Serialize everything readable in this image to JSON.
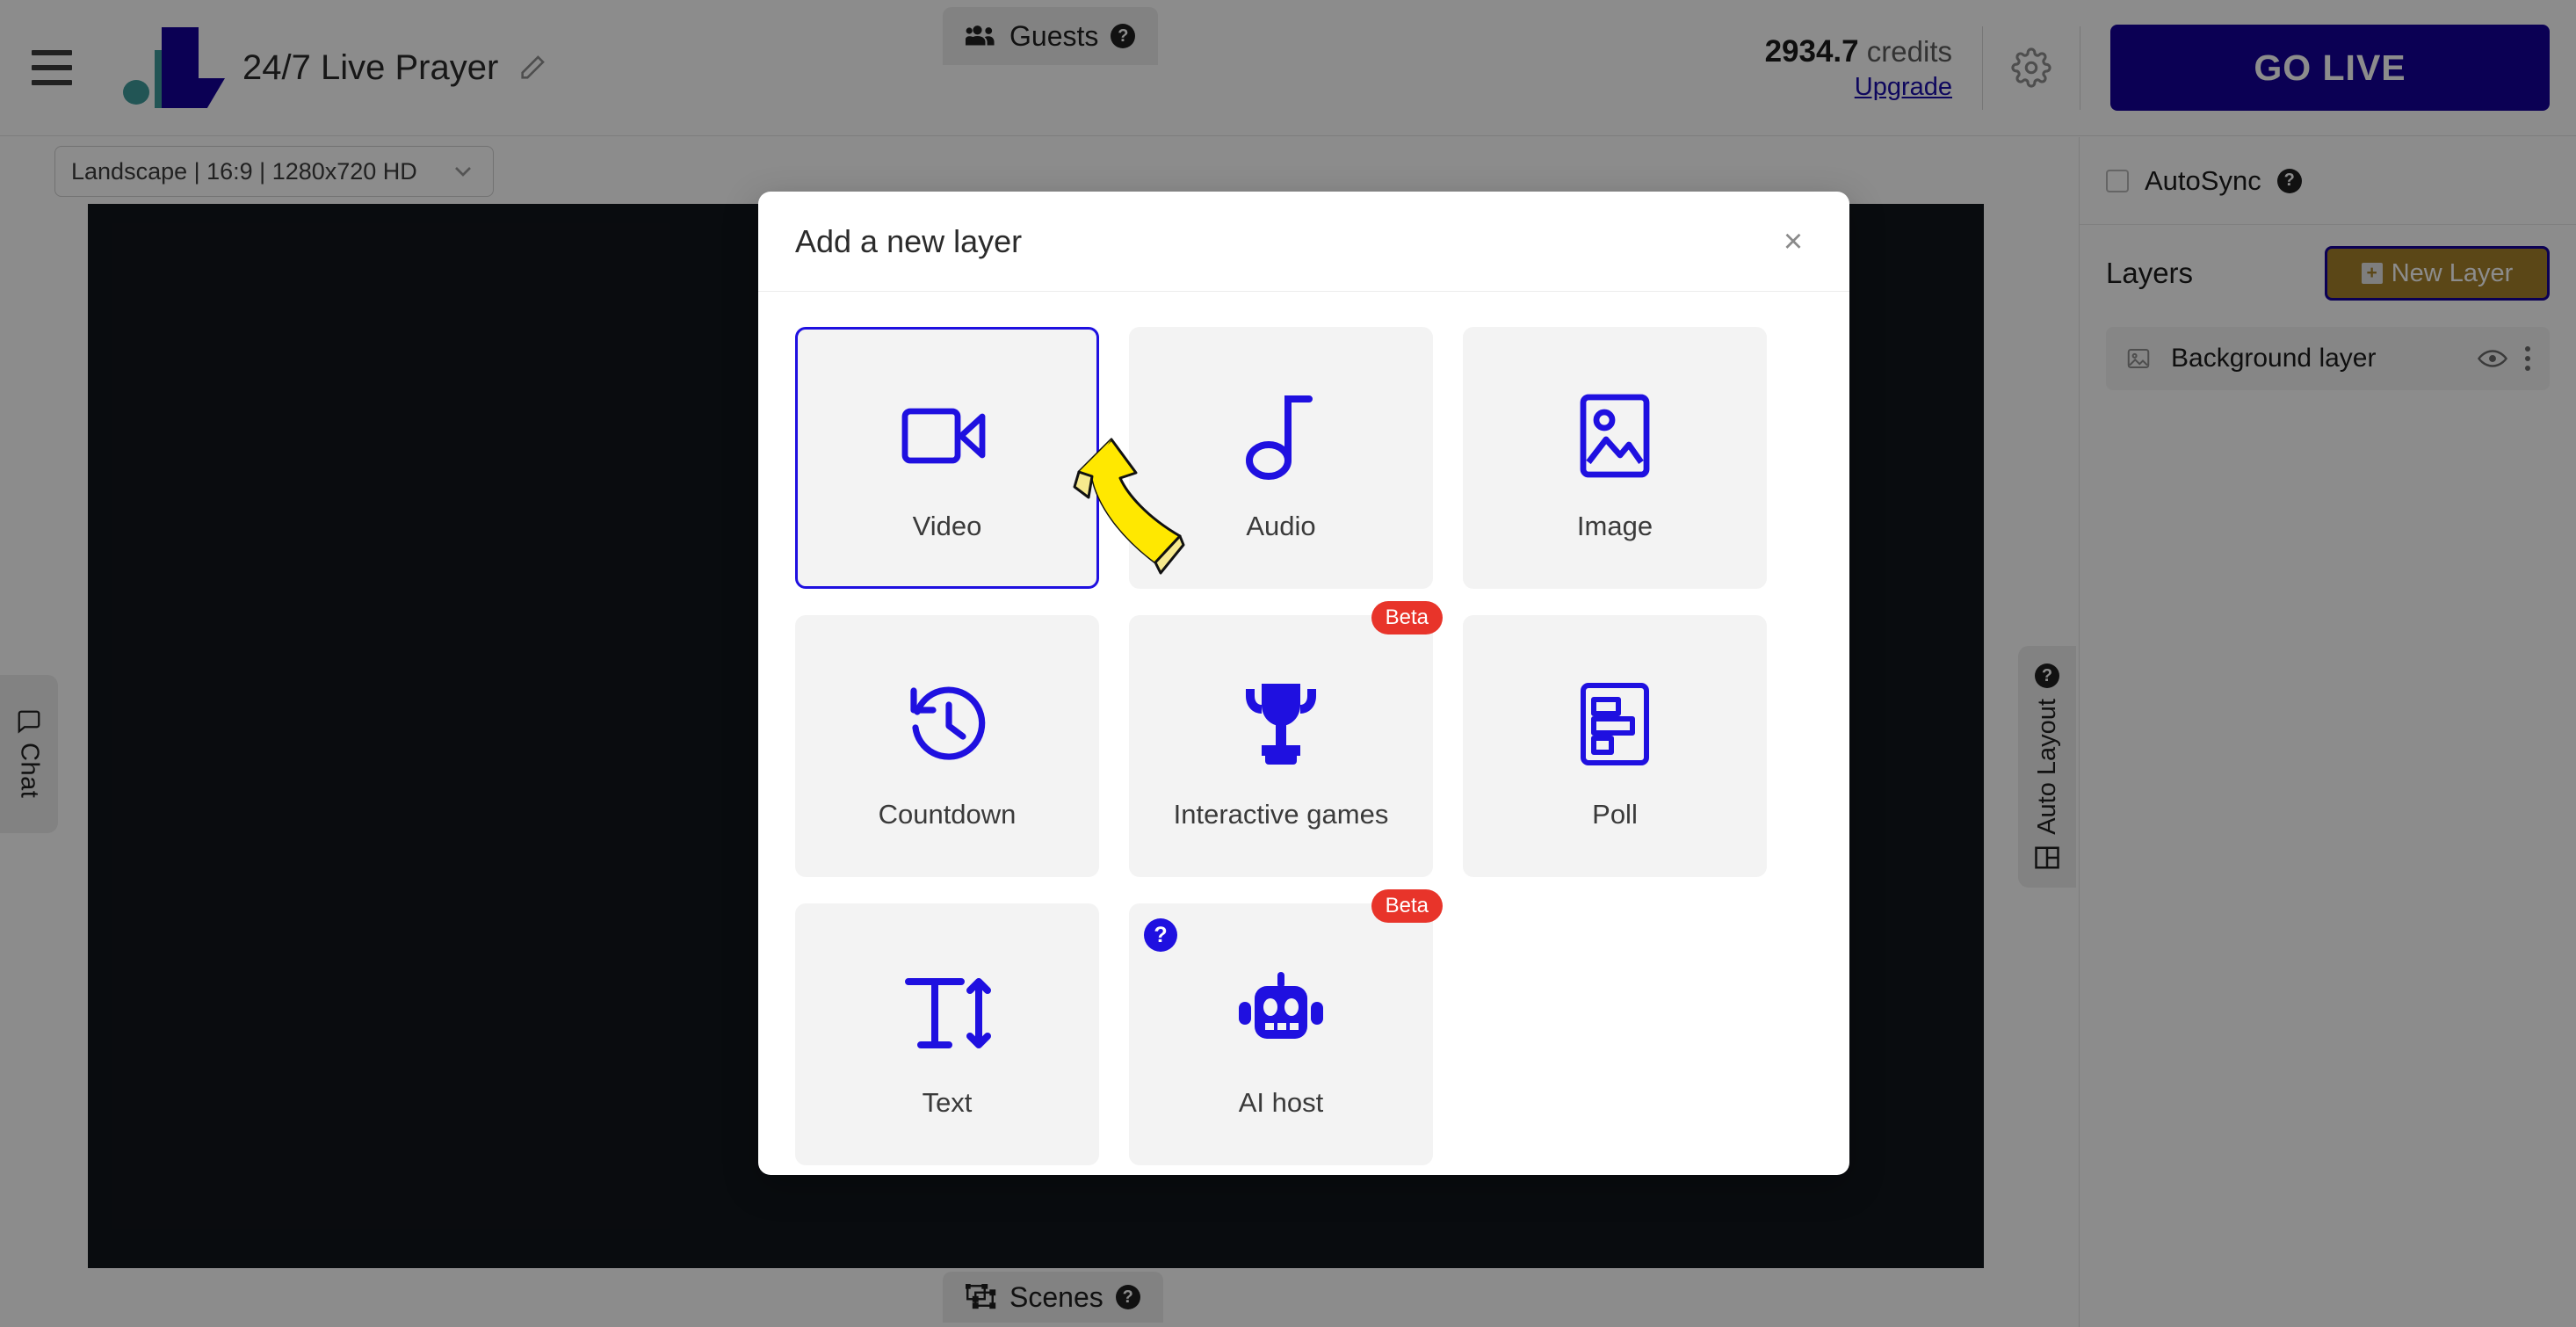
{
  "app": {
    "project_title": "24/7 Live Prayer",
    "logo_name": "livestream-logo"
  },
  "header": {
    "credits_value": "2934.7",
    "credits_label": "credits",
    "upgrade_label": "Upgrade",
    "go_live_label": "GO LIVE",
    "settings_icon": "gear-icon",
    "menu_icon": "hamburger-icon",
    "edit_icon": "pencil-icon"
  },
  "toolbar": {
    "ratio_value": "Landscape | 16:9 | 1280x720 HD",
    "guests_label": "Guests",
    "guests_help": "?"
  },
  "bottom": {
    "scenes_label": "Scenes",
    "scenes_help": "?"
  },
  "rails": {
    "chat_label": "Chat",
    "auto_layout_label": "Auto Layout",
    "auto_layout_help": "?"
  },
  "sidebar": {
    "autosync_label": "AutoSync",
    "autosync_help": "?",
    "autosync_checked": false,
    "layers_title": "Layers",
    "new_layer_label": "New Layer",
    "new_layer_plus": "+",
    "layers": [
      {
        "name": "Background layer",
        "icon": "image-icon",
        "visible": true
      }
    ]
  },
  "modal": {
    "title": "Add a new layer",
    "close_label": "×",
    "cards": [
      {
        "label": "Video",
        "icon": "video-camera-icon",
        "selected": true,
        "badge": null,
        "help": null
      },
      {
        "label": "Audio",
        "icon": "music-note-icon",
        "selected": false,
        "badge": null,
        "help": null
      },
      {
        "label": "Image",
        "icon": "picture-icon",
        "selected": false,
        "badge": null,
        "help": null
      },
      {
        "label": "Countdown",
        "icon": "clock-back-icon",
        "selected": false,
        "badge": null,
        "help": null
      },
      {
        "label": "Interactive games",
        "icon": "trophy-icon",
        "selected": false,
        "badge": "Beta",
        "help": null
      },
      {
        "label": "Poll",
        "icon": "poll-icon",
        "selected": false,
        "badge": null,
        "help": null
      },
      {
        "label": "Text",
        "icon": "text-size-icon",
        "selected": false,
        "badge": null,
        "help": null
      },
      {
        "label": "AI host",
        "icon": "robot-icon",
        "selected": false,
        "badge": "Beta",
        "help": "?"
      }
    ]
  },
  "annotation": {
    "arrow": "yellow-curved-arrow pointing to Video card"
  },
  "colors": {
    "brand_blue": "#14009a",
    "icon_blue": "#1f10e0",
    "badge_red": "#e8342a",
    "new_layer_gold": "#a7812a",
    "canvas_black": "#12161c",
    "annotation_yellow": "#ffe800"
  }
}
